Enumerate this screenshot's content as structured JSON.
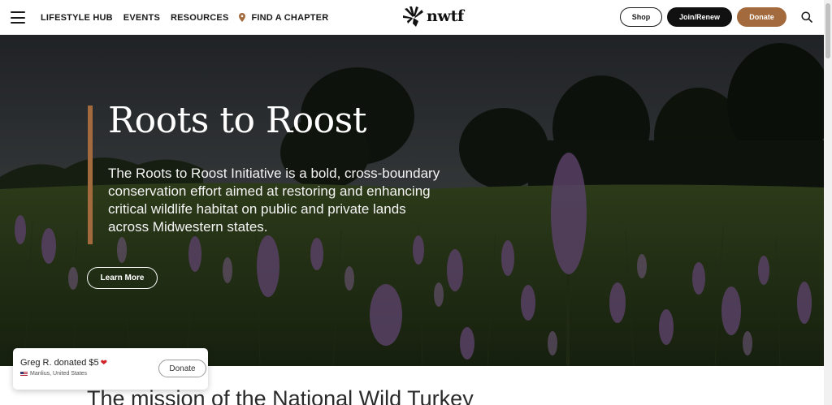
{
  "header": {
    "nav": [
      {
        "label": "LIFESTYLE HUB"
      },
      {
        "label": "EVENTS"
      },
      {
        "label": "RESOURCES"
      },
      {
        "label": "FIND A CHAPTER",
        "icon": "map-pin-icon"
      }
    ],
    "logo_text": "nwtf",
    "shop_label": "Shop",
    "join_label": "Join/Renew",
    "donate_label": "Donate"
  },
  "hero": {
    "title": "Roots to Roost",
    "description": "The Roots to Roost Initiative is a bold, cross-boundary conservation effort aimed at restoring and enhancing critical wildlife habitat on public and private lands across Midwestern states.",
    "cta_label": "Learn More"
  },
  "mission": {
    "heading": "The mission of the National Wild Turkey"
  },
  "donation_popup": {
    "text": "Greg R. donated $5",
    "location": "Manlius, United States",
    "button_label": "Donate"
  },
  "colors": {
    "accent": "#a36a3d",
    "dark_button": "#111111"
  }
}
